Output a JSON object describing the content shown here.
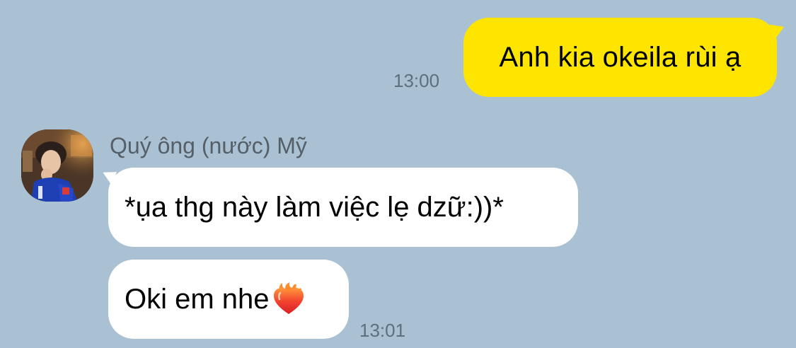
{
  "chat": {
    "outgoing": [
      {
        "text": "Anh kia okeila rùi ạ",
        "time": "13:00"
      }
    ],
    "sender": {
      "name": "Quý ông (nước) Mỹ",
      "avatar_icon": "user-avatar-photo"
    },
    "incoming": [
      {
        "text": "*ụa thg này làm việc lẹ dzữ:))*"
      },
      {
        "text": "Oki em nhe",
        "emoji": "heart-on-fire-icon",
        "time": "13:01"
      }
    ]
  },
  "colors": {
    "background": "#A9C1D3",
    "outgoing_bubble": "#FEE500",
    "incoming_bubble": "#FFFFFF",
    "timestamp": "#5E6F7D",
    "sender_name": "#555F68"
  }
}
